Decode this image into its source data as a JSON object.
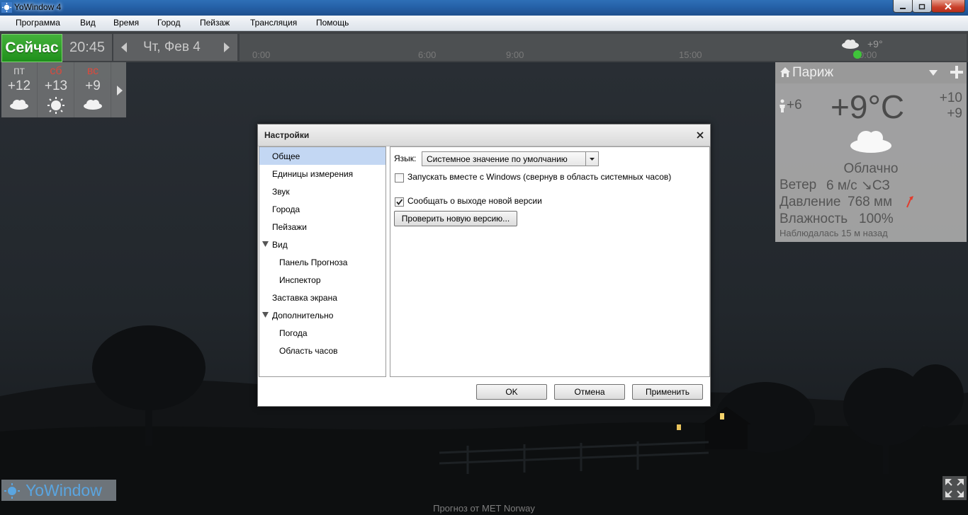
{
  "window": {
    "title": "YoWindow 4"
  },
  "menu": [
    "Программа",
    "Вид",
    "Время",
    "Город",
    "Пейзаж",
    "Трансляция",
    "Помощь"
  ],
  "topbar": {
    "now_label": "Сейчас",
    "time": "20:45",
    "date": "Чт, Фев 4",
    "timeline_ticks": [
      "0:00",
      "6:00",
      "9:00",
      "15:00",
      "0:00"
    ],
    "timeline_now_temp": "+9°"
  },
  "forecast": {
    "days": [
      {
        "name": "пт",
        "temp": "+12",
        "icon": "cloud-icon",
        "weekend": false
      },
      {
        "name": "сб",
        "temp": "+13",
        "icon": "sun-icon",
        "weekend": true
      },
      {
        "name": "вс",
        "temp": "+9",
        "icon": "cloud-icon",
        "weekend": true
      }
    ]
  },
  "weather": {
    "city": "Париж",
    "feels_like": "+6",
    "temperature": "+9°C",
    "high": "+10",
    "low": "+9",
    "condition": "Облачно",
    "wind_label": "Ветер",
    "wind_value": "6 м/с ↘СЗ",
    "pressure_label": "Давление",
    "pressure_value": "768 мм",
    "humidity_label": "Влажность",
    "humidity_value": "100%",
    "observed": "Наблюдалась 15 м назад"
  },
  "bottom": {
    "logo": "YoWindow",
    "credit": "Прогноз от MET Norway"
  },
  "dialog": {
    "title": "Настройки",
    "tree": [
      {
        "label": "Общее",
        "level": 0,
        "selected": true,
        "expandable": false
      },
      {
        "label": "Единицы измерения",
        "level": 0,
        "selected": false,
        "expandable": false
      },
      {
        "label": "Звук",
        "level": 0,
        "selected": false,
        "expandable": false
      },
      {
        "label": "Города",
        "level": 0,
        "selected": false,
        "expandable": false
      },
      {
        "label": "Пейзажи",
        "level": 0,
        "selected": false,
        "expandable": false
      },
      {
        "label": "Вид",
        "level": 0,
        "selected": false,
        "expandable": true
      },
      {
        "label": "Панель Прогноза",
        "level": 1,
        "selected": false,
        "expandable": false
      },
      {
        "label": "Инспектор",
        "level": 1,
        "selected": false,
        "expandable": false
      },
      {
        "label": "Заставка экрана",
        "level": 0,
        "selected": false,
        "expandable": false
      },
      {
        "label": "Дополнительно",
        "level": 0,
        "selected": false,
        "expandable": true
      },
      {
        "label": "Погода",
        "level": 1,
        "selected": false,
        "expandable": false
      },
      {
        "label": "Область часов",
        "level": 1,
        "selected": false,
        "expandable": false
      }
    ],
    "general": {
      "language_label": "Язык:",
      "language_value": "Системное значение по умолчанию",
      "autostart_label": "Запускать вместе с Windows (свернув в область системных часов)",
      "autostart_checked": false,
      "notify_label": "Сообщать о выходе новой версии",
      "notify_checked": true,
      "check_version_label": "Проверить новую версию..."
    },
    "buttons": {
      "ok": "OK",
      "cancel": "Отмена",
      "apply": "Применить"
    }
  },
  "colors": {
    "now_green": "#2a9d24",
    "selection": "#c3d7f3",
    "weekend_red": "#d94a3d",
    "logo_blue": "#5aa5e0"
  }
}
